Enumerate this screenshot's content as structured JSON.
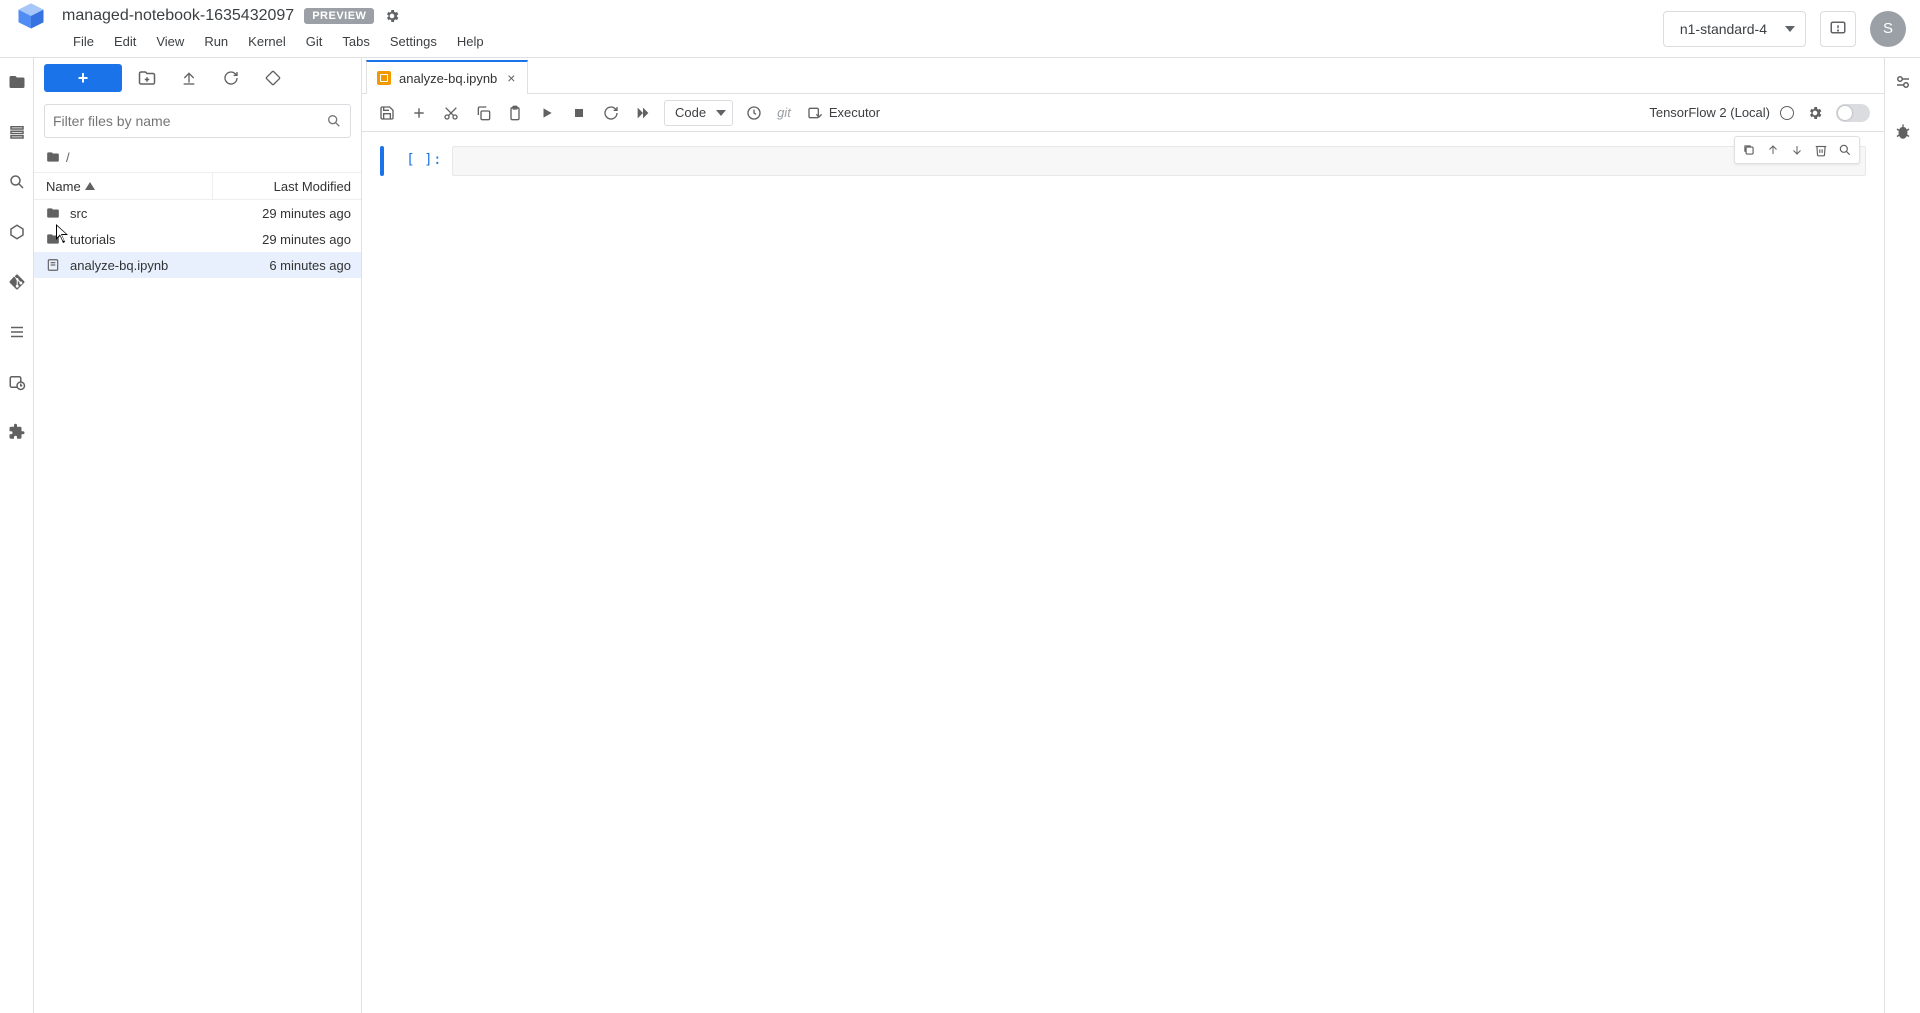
{
  "header": {
    "title": "managed-notebook-1635432097",
    "badge": "PREVIEW",
    "machine_type": "n1-standard-4",
    "avatar_initial": "S"
  },
  "menu": {
    "items": [
      "File",
      "Edit",
      "View",
      "Run",
      "Kernel",
      "Git",
      "Tabs",
      "Settings",
      "Help"
    ]
  },
  "filebrowser": {
    "filter_placeholder": "Filter files by name",
    "breadcrumb_root": "/",
    "columns": {
      "name": "Name",
      "modified": "Last Modified"
    },
    "items": [
      {
        "name": "src",
        "kind": "folder",
        "modified": "29 minutes ago",
        "selected": false
      },
      {
        "name": "tutorials",
        "kind": "folder",
        "modified": "29 minutes ago",
        "selected": false
      },
      {
        "name": "analyze-bq.ipynb",
        "kind": "notebook",
        "modified": "6 minutes ago",
        "selected": true
      }
    ]
  },
  "tabs": {
    "open": [
      {
        "label": "analyze-bq.ipynb",
        "kind": "notebook",
        "active": true
      }
    ]
  },
  "notebook_toolbar": {
    "celltype": "Code",
    "git_label": "git",
    "executor_label": "Executor",
    "kernel_label": "TensorFlow 2 (Local)"
  },
  "cell": {
    "prompt": "[ ]:",
    "content": ""
  }
}
